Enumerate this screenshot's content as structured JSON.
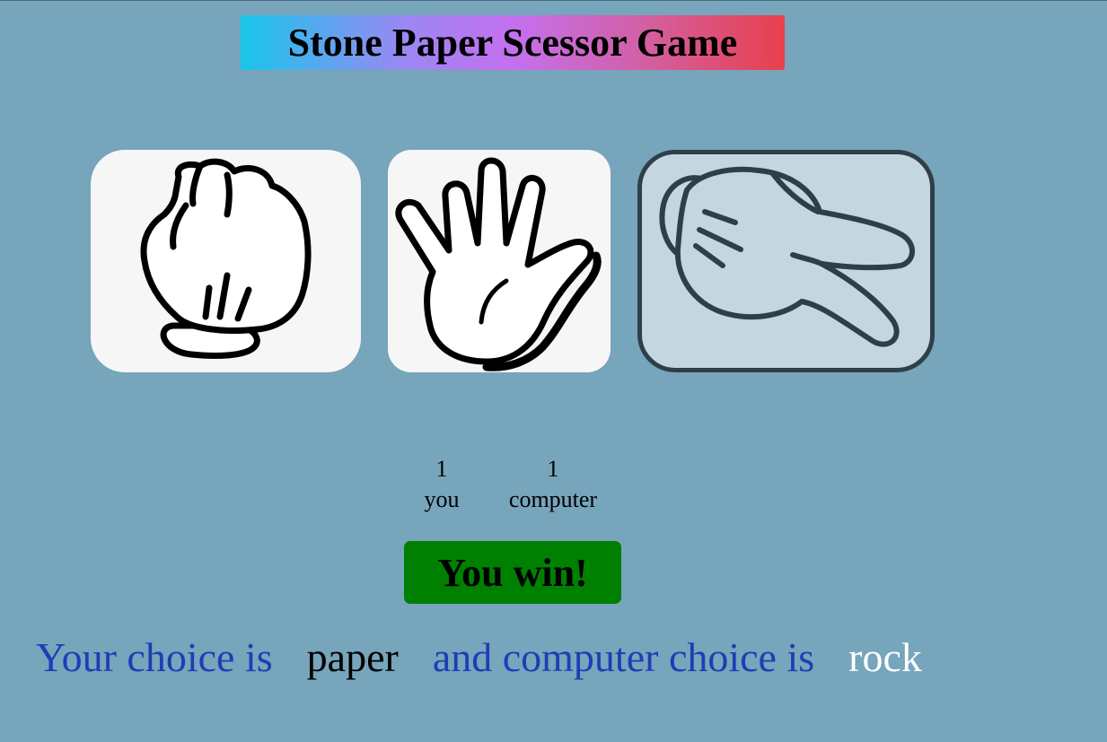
{
  "header": {
    "title": "Stone Paper Scessor Game"
  },
  "choices": [
    {
      "id": "rock",
      "icon": "fist-icon"
    },
    {
      "id": "paper",
      "icon": "open-hand-icon"
    },
    {
      "id": "scissors",
      "icon": "two-finger-hand-icon"
    }
  ],
  "scoreboard": {
    "user_score": "1",
    "user_label": "you",
    "computer_score": "1",
    "computer_label": "computer"
  },
  "message": {
    "text": "You win!",
    "color": "#008000"
  },
  "result": {
    "user_prefix": "Your choice is",
    "user_choice": "paper",
    "computer_prefix": "and computer choice is",
    "computer_choice": "rock"
  },
  "colors": {
    "background": "#76a5bc",
    "prefix_text": "#1f3db4"
  }
}
